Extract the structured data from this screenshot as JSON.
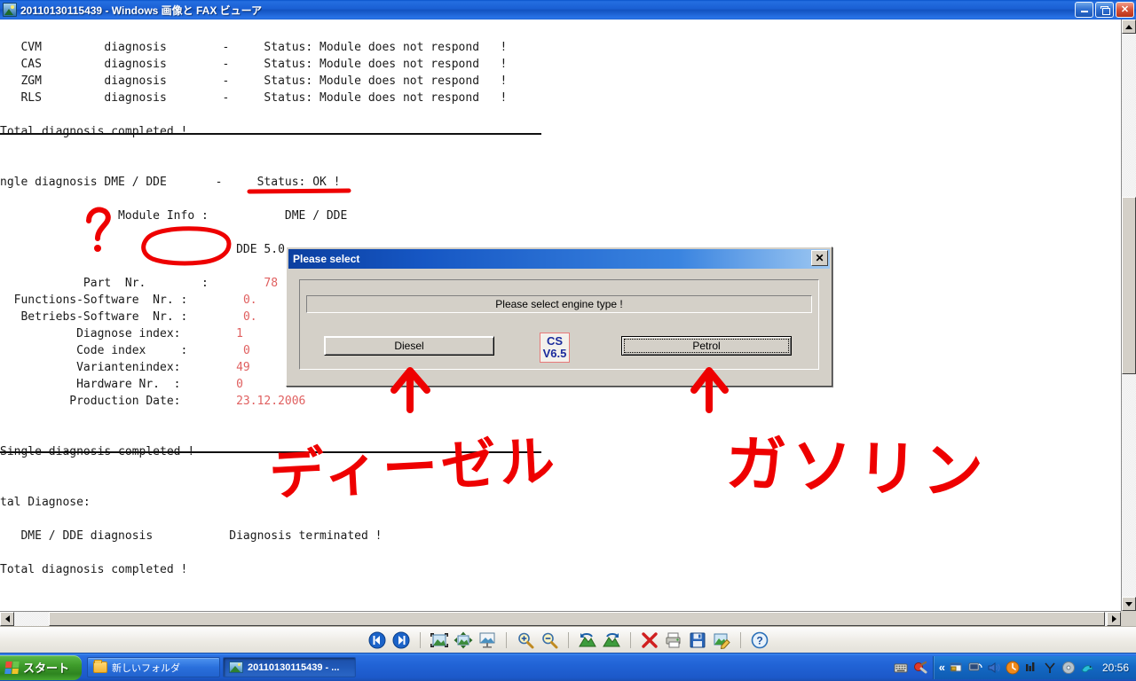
{
  "window": {
    "title": "20110130115439 - Windows 画像と FAX ビューア",
    "icon": "picture-icon",
    "minimize_label": "–",
    "maximize_label": "",
    "close_label": "✕"
  },
  "document": {
    "lines": [
      {
        "text": "   CVM         diagnosis        -     Status: Module does not respond   !"
      },
      {
        "text": "   CAS         diagnosis        -     Status: Module does not respond   !"
      },
      {
        "text": "   ZGM         diagnosis        -     Status: Module does not respond   !"
      },
      {
        "text": "   RLS         diagnosis        -     Status: Module does not respond   !"
      },
      {
        "text": ""
      },
      {
        "text": "Total diagnosis completed !"
      },
      {
        "text": ""
      },
      {
        "text": ""
      },
      {
        "text": "ngle diagnosis DME / DDE       -     Status: OK !"
      },
      {
        "text": ""
      },
      {
        "text": "                 Module Info :           DME / DDE"
      },
      {
        "text": ""
      },
      {
        "text": "                                  DDE 5.0"
      },
      {
        "text": ""
      },
      {
        "text": "            Part  Nr.        :        78"
      },
      {
        "text": "  Functions-Software  Nr. :        0."
      },
      {
        "text": "   Betriebs-Software  Nr. :        0."
      },
      {
        "text": "           Diagnose index:        1"
      },
      {
        "text": "           Code index     :        0"
      },
      {
        "text": "           Variantenindex:        49"
      },
      {
        "text": "           Hardware Nr.  :        0"
      },
      {
        "text": "          Production Date:        23.12.2006"
      },
      {
        "text": ""
      },
      {
        "text": ""
      },
      {
        "text": "Single diagnosis completed !"
      },
      {
        "text": ""
      },
      {
        "text": ""
      },
      {
        "text": "tal Diagnose:"
      },
      {
        "text": ""
      },
      {
        "text": "   DME / DDE diagnosis           Diagnosis terminated !"
      },
      {
        "text": ""
      },
      {
        "text": "Total diagnosis completed !"
      }
    ],
    "values_color": "#e06060"
  },
  "dialog": {
    "title": "Please select",
    "close_label": "✕",
    "message": "Please select engine type !",
    "diesel_button": "Diesel",
    "petrol_button": "Petrol",
    "logo_line1": "CS",
    "logo_line2": "V6.5",
    "logo_text_color": "#1a2a9c",
    "logo_border_color": "#e87a7a"
  },
  "annotations": {
    "color": "#ee0000",
    "diesel_label": "ディーゼル",
    "petrol_label": "ガソリン",
    "question_mark": "?",
    "circled_value": "DDE 5.0",
    "underlined_status": "Status: OK !"
  },
  "viewer_toolbar": {
    "items": [
      {
        "name": "previous-image-button",
        "label": "Previous Image"
      },
      {
        "name": "next-image-button",
        "label": "Next Image"
      },
      {
        "name": "best-fit-button",
        "label": "Best Fit"
      },
      {
        "name": "actual-size-button",
        "label": "Actual Size"
      },
      {
        "name": "start-slideshow-button",
        "label": "Start Slide Show"
      },
      {
        "name": "zoom-in-button",
        "label": "Zoom In"
      },
      {
        "name": "zoom-out-button",
        "label": "Zoom Out"
      },
      {
        "name": "rotate-counterclockwise-button",
        "label": "Rotate Counterclockwise"
      },
      {
        "name": "rotate-clockwise-button",
        "label": "Rotate Clockwise"
      },
      {
        "name": "delete-button",
        "label": "Delete"
      },
      {
        "name": "print-button",
        "label": "Print"
      },
      {
        "name": "save-as-button",
        "label": "Copy To"
      },
      {
        "name": "edit-image-button",
        "label": "Edit"
      },
      {
        "name": "help-button",
        "label": "Help"
      }
    ]
  },
  "taskbar": {
    "start_label": "スタート",
    "tasks": [
      {
        "label": "新しいフォルダ",
        "icon": "folder-icon",
        "active": false
      },
      {
        "label": "20110130115439 - ...",
        "icon": "picture-icon",
        "active": true
      }
    ],
    "quick_icons": [
      "keyboard-ime-icon",
      "ime-tool-icon"
    ],
    "tray_expand": "«",
    "tray_icons": [
      "security-icon",
      "network-icon",
      "volume-icon",
      "update-icon",
      "monitor-icon",
      "wireless-icon",
      "disc-icon",
      "bird-icon"
    ],
    "clock": "20:56"
  }
}
